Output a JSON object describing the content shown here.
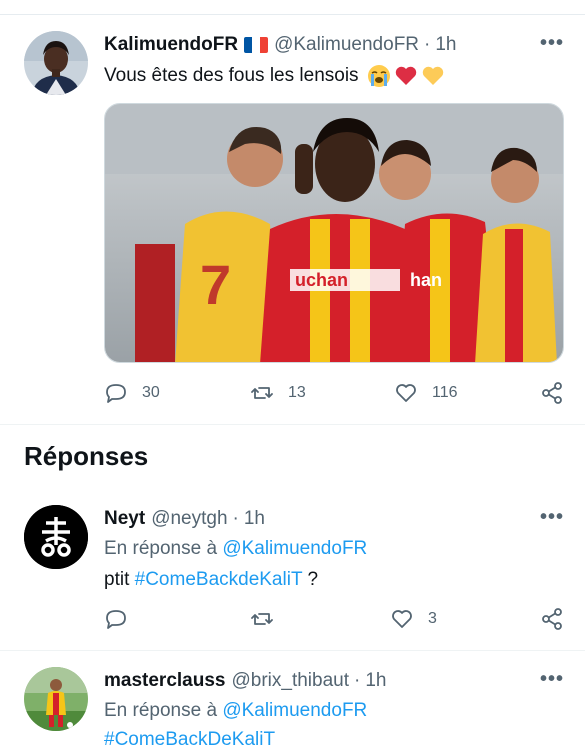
{
  "main_tweet": {
    "display_name": "KalimuendoFR",
    "flag_icon": "france-flag-icon",
    "handle": "@KalimuendoFR",
    "separator": "·",
    "time": "1h",
    "more_icon": "more-options-icon",
    "text": "Vous êtes des fous les lensois",
    "emojis": [
      "loudly-crying-face-icon",
      "red-heart-icon",
      "yellow-heart-icon"
    ],
    "media_icon": "photo-of-lens-football-players",
    "reply_count": "30",
    "retweet_count": "13",
    "like_count": "116"
  },
  "replies_section": {
    "title": "Réponses"
  },
  "replies": [
    {
      "display_name": "Neyt",
      "handle": "@neytgh",
      "separator": "·",
      "time": "1h",
      "reply_prefix": "En réponse à",
      "reply_to": "@KalimuendoFR",
      "text_before": "ptit",
      "hashtag": "#ComeBackdeKaliT",
      "text_after": " ?",
      "like_count": "3"
    },
    {
      "display_name": "masterclauss",
      "handle": "@brix_thibaut",
      "separator": "·",
      "time": "1h",
      "reply_prefix": "En réponse à",
      "reply_to": "@KalimuendoFR",
      "hashtag": "#ComeBackDeKaliT"
    }
  ],
  "colors": {
    "link": "#1d9bf0",
    "muted": "#536471",
    "text": "#0f1419",
    "divider": "#eff3f4",
    "lens_red": "#d4202a",
    "lens_yellow": "#f5c518"
  }
}
